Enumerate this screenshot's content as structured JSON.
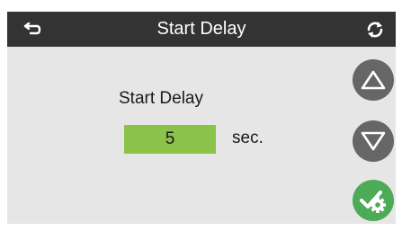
{
  "header": {
    "title": "Start Delay",
    "back_icon": "back-arrow-icon",
    "refresh_icon": "refresh-icon"
  },
  "setting": {
    "label": "Start Delay",
    "value": "5",
    "unit": "sec."
  },
  "controls": {
    "increase_icon": "triangle-up-icon",
    "decrease_icon": "triangle-down-icon",
    "confirm_icon": "check-gear-icon"
  },
  "colors": {
    "header_bg": "#333333",
    "body_bg": "#e6e6e6",
    "value_bg": "#8bc34a",
    "arrow_button_bg": "#666666",
    "confirm_button_bg": "#4daa57"
  }
}
